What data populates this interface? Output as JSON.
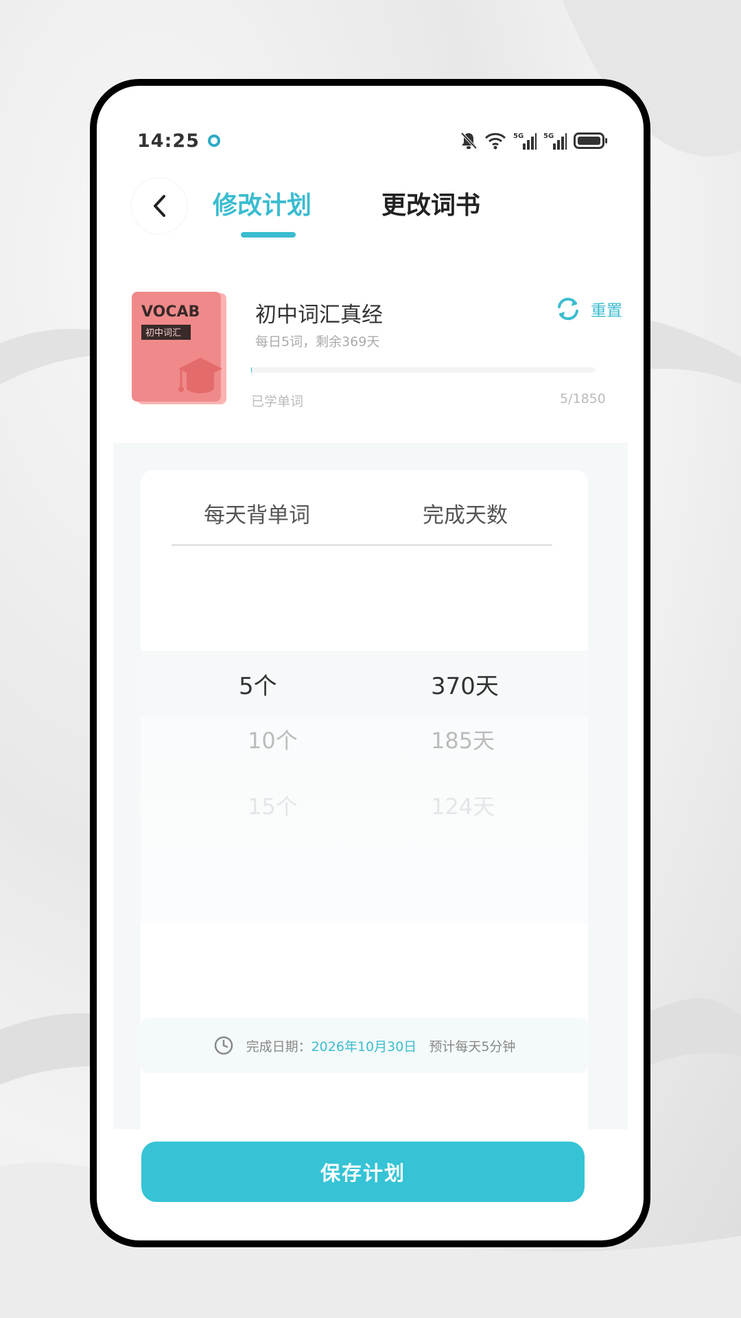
{
  "status_bar": {
    "time": "14:25",
    "icons": [
      "app-notification-icon",
      "mute-bell-icon",
      "wifi-icon",
      "5g-signal-icon",
      "5g-signal-icon",
      "battery-icon"
    ]
  },
  "header": {
    "back_icon": "chevron-left-icon",
    "tabs": [
      {
        "label": "修改计划",
        "active": true
      },
      {
        "label": "更改词书",
        "active": false
      }
    ]
  },
  "book": {
    "cover_title": "VOCAB",
    "cover_subtitle": "初中词汇",
    "title": "初中词汇真经",
    "subtitle": "每日5词，剩余369天",
    "reset_label": "重置",
    "learned_label": "已学单词",
    "learned_count": "5/1850",
    "progress": 0.0027
  },
  "picker": {
    "col_left_header": "每天背单词",
    "col_right_header": "完成天数",
    "rows": [
      {
        "words": "5个",
        "days": "370天",
        "selected": true
      },
      {
        "words": "10个",
        "days": "185天",
        "selected": false
      },
      {
        "words": "15个",
        "days": "124天",
        "selected": false
      }
    ]
  },
  "finish": {
    "label": "完成日期：",
    "date": "2026年10月30日",
    "estimate": "预计每天5分钟"
  },
  "save_button": "保存计划",
  "colors": {
    "accent": "#3bbcd0",
    "button": "#36c3d6",
    "book_cover": "#f08a8a"
  }
}
